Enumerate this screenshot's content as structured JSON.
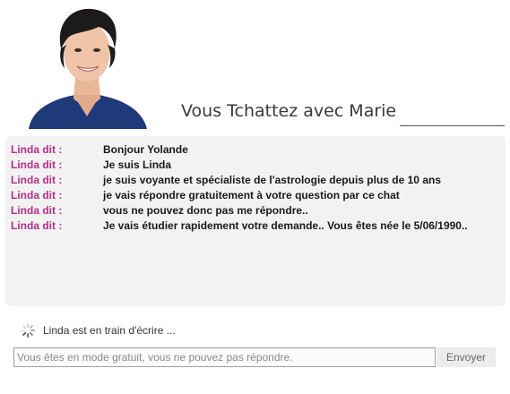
{
  "header": {
    "title": "Vous Tchattez avec Marie",
    "avatar_alt": "Marie"
  },
  "messages": [
    {
      "who": "Linda dit :",
      "text": "Bonjour Yolande"
    },
    {
      "who": "Linda dit :",
      "text": "Je suis Linda"
    },
    {
      "who": "Linda dit :",
      "text": "je suis voyante et spécialiste de l'astrologie depuis plus de 10 ans"
    },
    {
      "who": "Linda dit :",
      "text": "je vais répondre gratuitement à votre question par ce chat"
    },
    {
      "who": "Linda dit :",
      "text": "vous ne pouvez donc pas me répondre.."
    },
    {
      "who": "Linda dit :",
      "text": "Je vais étudier rapidement votre demande.. Vous êtes née le 5/06/1990.."
    }
  ],
  "typing": {
    "icon": "spinner-icon",
    "label": "Linda est en train d'écrire ..."
  },
  "composer": {
    "value": "",
    "placeholder": "Vous êtes en mode gratuit, vous ne pouvez pas répondre.",
    "send_label": "Envoyer"
  },
  "colors": {
    "sender": "#b0308a",
    "chat_bg": "#f2f2f2",
    "send_bg": "#ececec"
  }
}
